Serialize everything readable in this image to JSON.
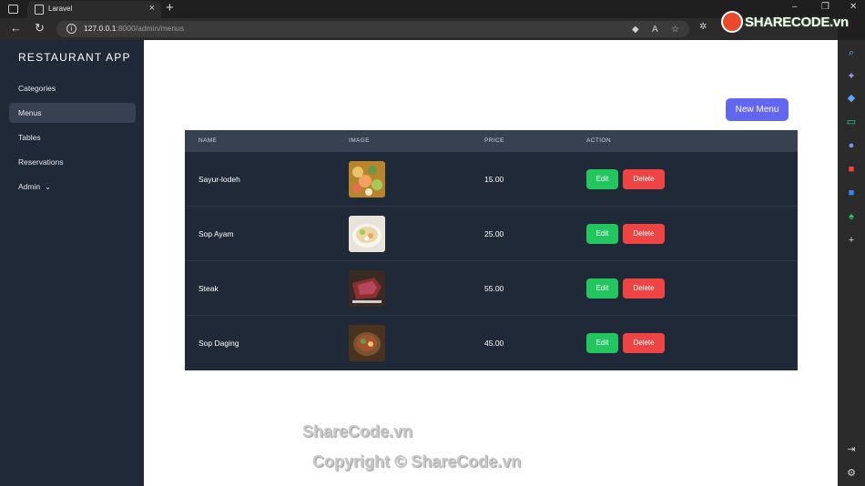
{
  "browser": {
    "tab_title": "Laravel",
    "url_host": "127.0.0.1",
    "url_rest": ":8000/admin/menus",
    "new_tab": "+",
    "tab_close": "×",
    "window_minimize": "–",
    "window_maximize": "❐",
    "window_close": "✕"
  },
  "sidebar": {
    "title": "RESTAURANT APP",
    "items": [
      {
        "label": "Categories",
        "active": false
      },
      {
        "label": "Menus",
        "active": true
      },
      {
        "label": "Tables",
        "active": false
      },
      {
        "label": "Reservations",
        "active": false
      },
      {
        "label": "Admin",
        "active": false,
        "dropdown": true
      }
    ]
  },
  "main": {
    "new_menu_label": "New Menu",
    "columns": [
      "NAME",
      "IMAGE",
      "PRICE",
      "ACTION"
    ],
    "rows": [
      {
        "name": "Sayur-lodeh",
        "price": "15.00"
      },
      {
        "name": "Sop Ayam",
        "price": "25.00"
      },
      {
        "name": "Steak",
        "price": "55.00"
      },
      {
        "name": "Sop Daging",
        "price": "45.00"
      }
    ],
    "edit_label": "Edit",
    "delete_label": "Delete"
  },
  "watermark": {
    "line1": "ShareCode.vn",
    "line2": "Copyright © ShareCode.vn",
    "logo": "SHARECODE.vn"
  },
  "colors": {
    "sidebar_bg": "#1f2937",
    "new_menu_button": "#6366f1",
    "edit_button": "#22c55e",
    "delete_button": "#ef4444"
  }
}
